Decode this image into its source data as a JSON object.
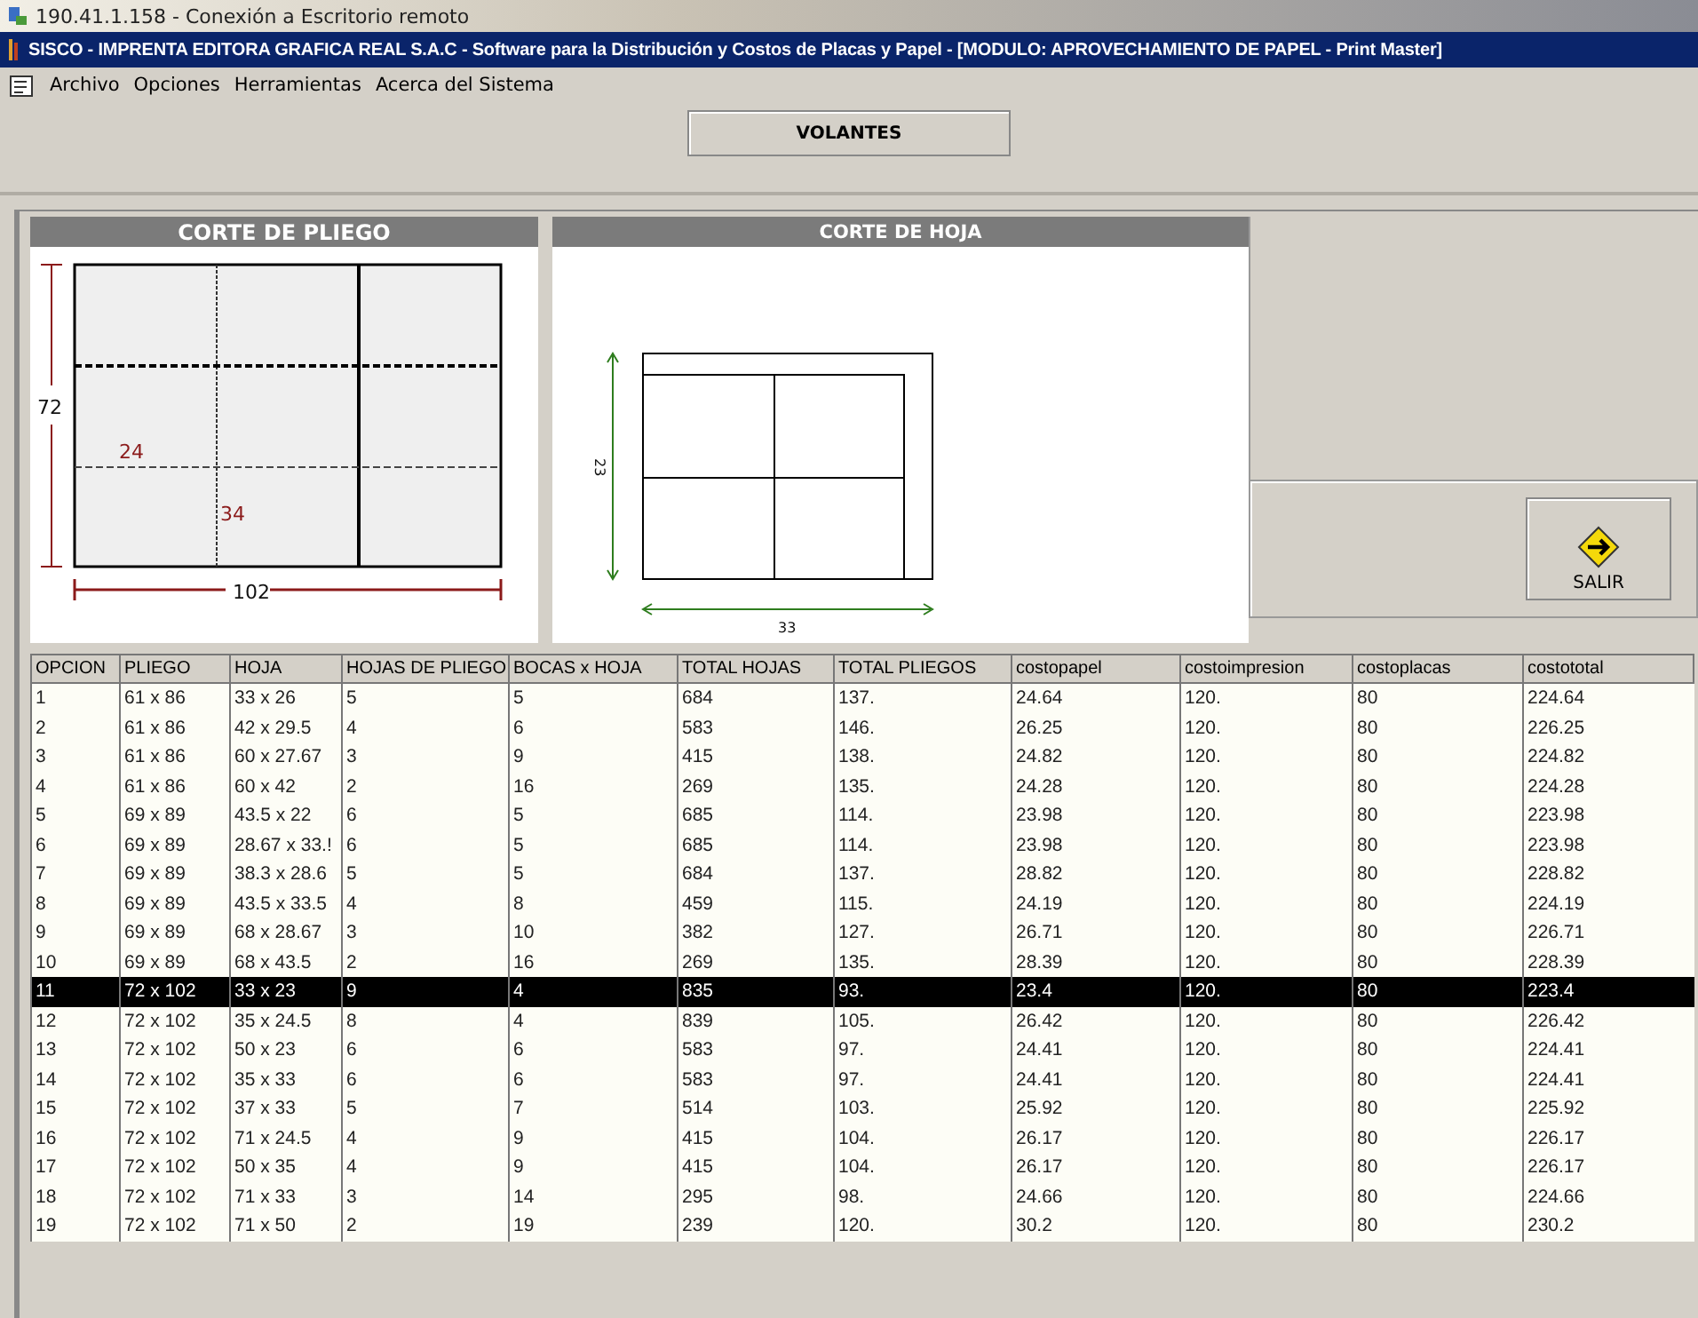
{
  "remote_window": {
    "title": "190.41.1.158 - Conexión a Escritorio remoto"
  },
  "app": {
    "title": "SISCO - IMPRENTA EDITORA GRAFICA REAL S.A.C - Software para la Distribución y Costos de Placas y Papel - [MODULO: APROVECHAMIENTO DE PAPEL - Print Master]"
  },
  "menu": [
    "Archivo",
    "Opciones",
    "Herramientas",
    "Acerca del Sistema"
  ],
  "mode_label": "VOLANTES",
  "pliego_panel": {
    "title": "CORTE DE PLIEGO",
    "width_label": "102",
    "height_label": "72",
    "piece_labels": [
      "24",
      "34"
    ]
  },
  "hoja_panel": {
    "title": "CORTE DE HOJA",
    "height_label": "23",
    "width_label": "33"
  },
  "exit_button": "SALIR",
  "table": {
    "columns": [
      "OPCION",
      "PLIEGO",
      "HOJA",
      "HOJAS DE PLIEGO",
      "BOCAS x HOJA",
      "TOTAL HOJAS",
      "TOTAL PLIEGOS",
      "costopapel",
      "costoimpresion",
      "costoplacas",
      "costototal"
    ],
    "rows": [
      {
        "cells": [
          "1",
          "61 x 86",
          "33 x 26",
          "5",
          "5",
          "684",
          "137.",
          "24.64",
          "120.",
          "80",
          "224.64"
        ],
        "selected": false
      },
      {
        "cells": [
          "2",
          "61 x 86",
          "42 x 29.5",
          "4",
          "6",
          "583",
          "146.",
          "26.25",
          "120.",
          "80",
          "226.25"
        ],
        "selected": false
      },
      {
        "cells": [
          "3",
          "61 x 86",
          "60 x 27.67",
          "3",
          "9",
          "415",
          "138.",
          "24.82",
          "120.",
          "80",
          "224.82"
        ],
        "selected": false
      },
      {
        "cells": [
          "4",
          "61 x 86",
          "60 x 42",
          "2",
          "16",
          "269",
          "135.",
          "24.28",
          "120.",
          "80",
          "224.28"
        ],
        "selected": false
      },
      {
        "cells": [
          "5",
          "69 x 89",
          "43.5 x 22",
          "6",
          "5",
          "685",
          "114.",
          "23.98",
          "120.",
          "80",
          "223.98"
        ],
        "selected": false
      },
      {
        "cells": [
          "6",
          "69 x 89",
          "28.67 x 33.!",
          "6",
          "5",
          "685",
          "114.",
          "23.98",
          "120.",
          "80",
          "223.98"
        ],
        "selected": false
      },
      {
        "cells": [
          "7",
          "69 x 89",
          "38.3 x 28.6",
          "5",
          "5",
          "684",
          "137.",
          "28.82",
          "120.",
          "80",
          "228.82"
        ],
        "selected": false
      },
      {
        "cells": [
          "8",
          "69 x 89",
          "43.5 x 33.5",
          "4",
          "8",
          "459",
          "115.",
          "24.19",
          "120.",
          "80",
          "224.19"
        ],
        "selected": false
      },
      {
        "cells": [
          "9",
          "69 x 89",
          "68 x 28.67",
          "3",
          "10",
          "382",
          "127.",
          "26.71",
          "120.",
          "80",
          "226.71"
        ],
        "selected": false
      },
      {
        "cells": [
          "10",
          "69 x 89",
          "68 x 43.5",
          "2",
          "16",
          "269",
          "135.",
          "28.39",
          "120.",
          "80",
          "228.39"
        ],
        "selected": false
      },
      {
        "cells": [
          "11",
          "72 x 102",
          "33 x 23",
          "9",
          "4",
          "835",
          "93.",
          "23.4",
          "120.",
          "80",
          "223.4"
        ],
        "selected": true
      },
      {
        "cells": [
          "12",
          "72 x 102",
          "35 x 24.5",
          "8",
          "4",
          "839",
          "105.",
          "26.42",
          "120.",
          "80",
          "226.42"
        ],
        "selected": false
      },
      {
        "cells": [
          "13",
          "72 x 102",
          "50 x 23",
          "6",
          "6",
          "583",
          "97.",
          "24.41",
          "120.",
          "80",
          "224.41"
        ],
        "selected": false
      },
      {
        "cells": [
          "14",
          "72 x 102",
          "35 x 33",
          "6",
          "6",
          "583",
          "97.",
          "24.41",
          "120.",
          "80",
          "224.41"
        ],
        "selected": false
      },
      {
        "cells": [
          "15",
          "72 x 102",
          "37 x 33",
          "5",
          "7",
          "514",
          "103.",
          "25.92",
          "120.",
          "80",
          "225.92"
        ],
        "selected": false
      },
      {
        "cells": [
          "16",
          "72 x 102",
          "71 x 24.5",
          "4",
          "9",
          "415",
          "104.",
          "26.17",
          "120.",
          "80",
          "226.17"
        ],
        "selected": false
      },
      {
        "cells": [
          "17",
          "72 x 102",
          "50 x 35",
          "4",
          "9",
          "415",
          "104.",
          "26.17",
          "120.",
          "80",
          "226.17"
        ],
        "selected": false
      },
      {
        "cells": [
          "18",
          "72 x 102",
          "71 x 33",
          "3",
          "14",
          "295",
          "98.",
          "24.66",
          "120.",
          "80",
          "224.66"
        ],
        "selected": false
      },
      {
        "cells": [
          "19",
          "72 x 102",
          "71 x 50",
          "2",
          "19",
          "239",
          "120.",
          "30.2",
          "120.",
          "80",
          "230.2"
        ],
        "selected": false
      }
    ]
  }
}
